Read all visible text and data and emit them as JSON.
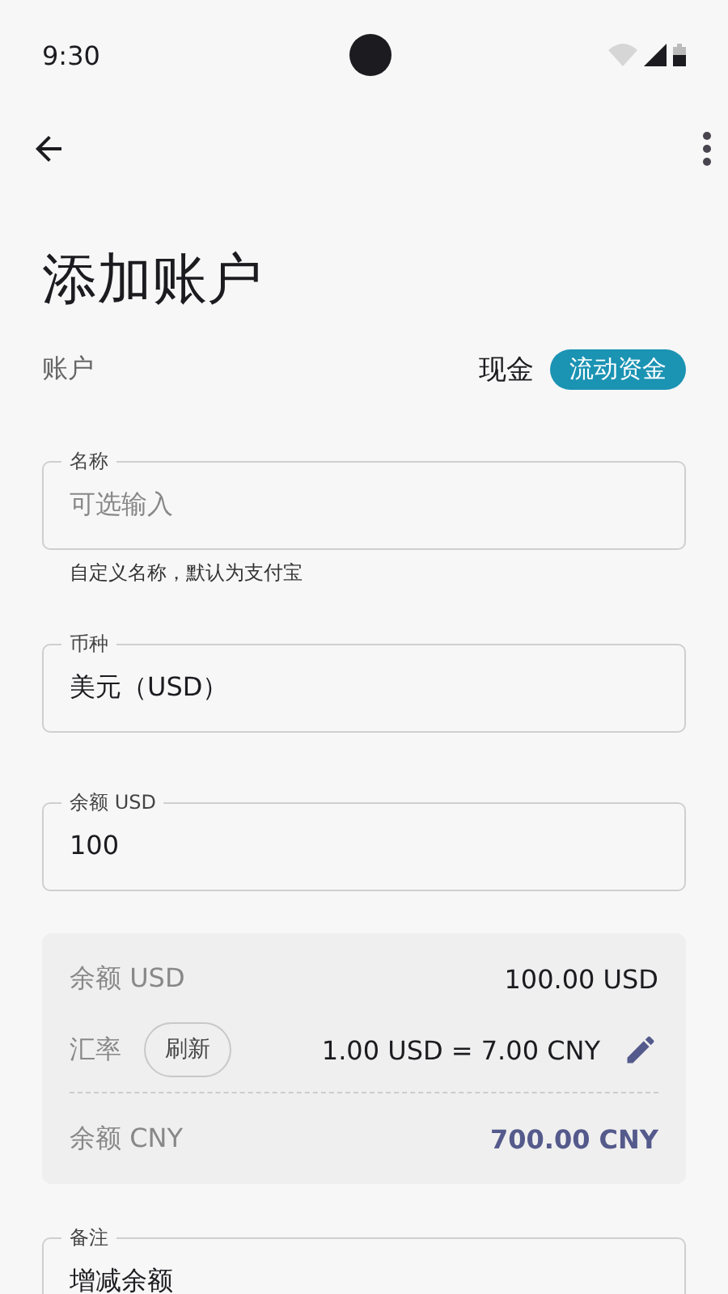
{
  "status_bar": {
    "time": "9:30"
  },
  "title": "添加账户",
  "account": {
    "label": "账户",
    "value": "现金",
    "chip": "流动资金"
  },
  "fields": [
    {
      "label": "名称",
      "placeholder": "可选输入",
      "helper": "自定义名称，默认为支付宝"
    },
    {
      "label": "币种",
      "value": "美元（USD）"
    },
    {
      "label": "余额 USD",
      "value": "100"
    }
  ],
  "summary": [
    {
      "kind": "plain",
      "label": "余额 USD",
      "value": "100.00 USD"
    },
    {
      "kind": "rate",
      "label": "汇率",
      "button": "刷新",
      "value": "1.00 USD = 7.00 CNY"
    },
    {
      "kind": "total",
      "label": "余额 CNY",
      "value": "700.00 CNY"
    }
  ],
  "note_field": {
    "label": "备注",
    "value": "增减余额"
  }
}
